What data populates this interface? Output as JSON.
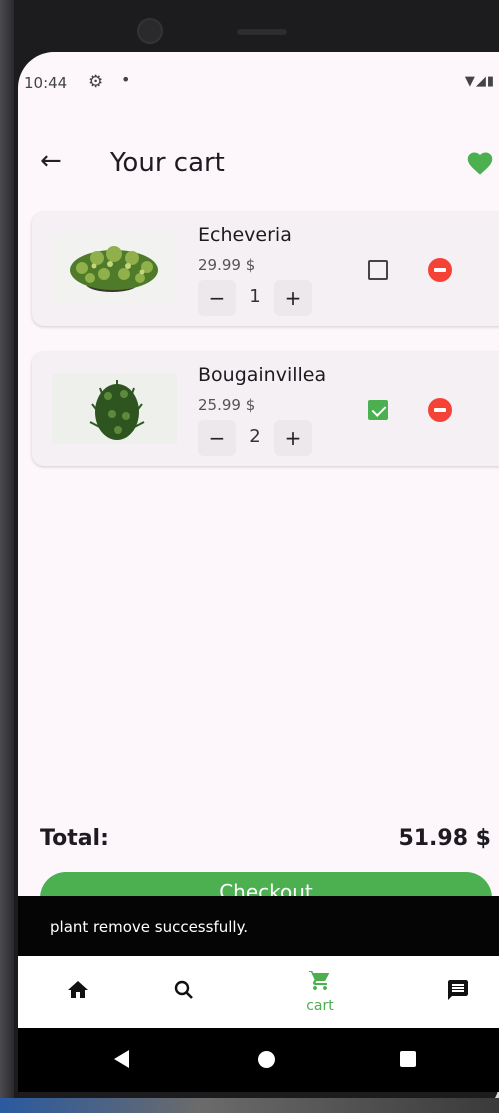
{
  "status_bar": {
    "time": "10:44",
    "dot": "•"
  },
  "app_bar": {
    "title": "Your cart"
  },
  "cart_items": [
    {
      "name": "Echeveria",
      "price": "29.99 $",
      "quantity": "1",
      "checked": false
    },
    {
      "name": "Bougainvillea",
      "price": "25.99 $",
      "quantity": "2",
      "checked": true
    }
  ],
  "qty_controls": {
    "minus": "−",
    "plus": "+"
  },
  "total": {
    "label": "Total:",
    "value": "51.98 $"
  },
  "checkout": {
    "label": "Checkout"
  },
  "snackbar": {
    "text": "plant remove successfully."
  },
  "bottom_nav": {
    "cart_label": "cart"
  },
  "colors": {
    "accent": "#4caf50",
    "remove": "#f44336",
    "background": "#fdf7fc"
  }
}
